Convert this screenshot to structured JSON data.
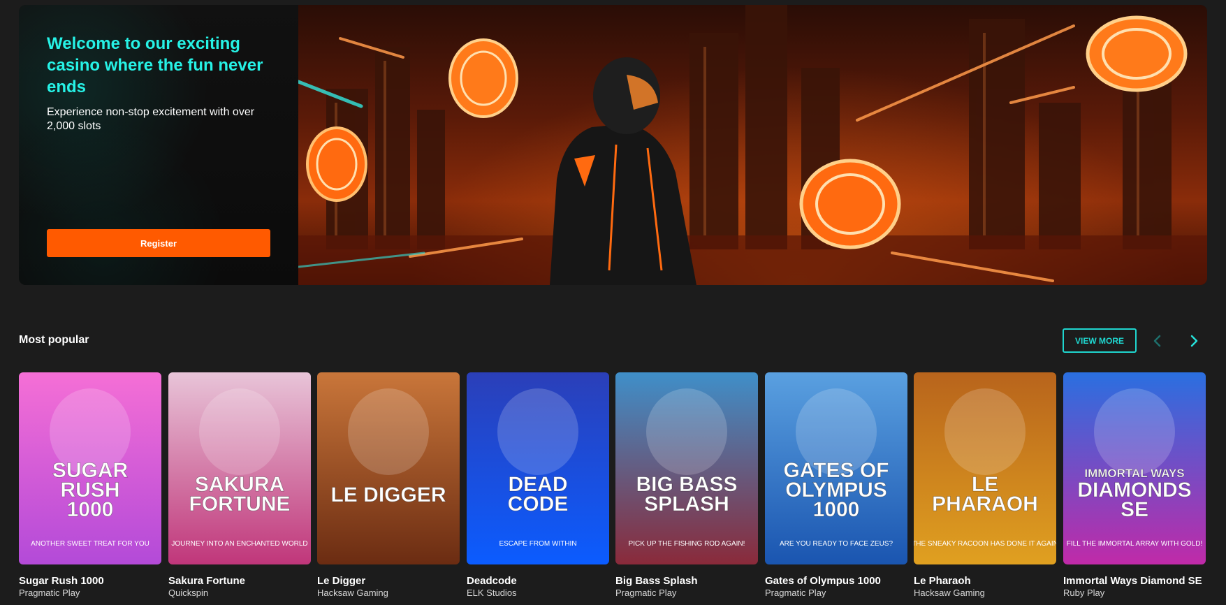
{
  "hero": {
    "title": "Welcome to our exciting casino where the fun never ends",
    "subtitle": "Experience non-stop excitement with over 2,000 slots",
    "register_label": "Register"
  },
  "popular": {
    "title": "Most popular",
    "view_more_label": "VIEW MORE",
    "prev_icon": "chevron-left-icon",
    "next_icon": "chevron-right-icon",
    "games": [
      {
        "name": "Sugar Rush 1000",
        "provider": "Pragmatic Play",
        "art_title": [
          "SUGAR",
          "RUSH",
          "1000"
        ],
        "tagline": "ANOTHER SWEET TREAT FOR YOU",
        "colors": [
          "#f56fd6",
          "#b34ad8"
        ]
      },
      {
        "name": "Sakura Fortune",
        "provider": "Quickspin",
        "art_title": [
          "SAKURA",
          "FORTUNE"
        ],
        "tagline": "JOURNEY INTO AN ENCHANTED WORLD",
        "colors": [
          "#e8c4d8",
          "#c0367a"
        ]
      },
      {
        "name": "Le Digger",
        "provider": "Hacksaw Gaming",
        "art_title": [
          "LE DIGGER"
        ],
        "tagline": "",
        "colors": [
          "#c9763a",
          "#6b2c12"
        ]
      },
      {
        "name": "Deadcode",
        "provider": "ELK Studios",
        "art_title": [
          "DEAD",
          "CODE"
        ],
        "tagline": "ESCAPE FROM WITHIN",
        "colors": [
          "#2b3fb8",
          "#0b5cff"
        ]
      },
      {
        "name": "Big Bass Splash",
        "provider": "Pragmatic Play",
        "art_title": [
          "BIG BASS",
          "SPLASH"
        ],
        "tagline": "PICK UP THE FISHING ROD AGAIN!",
        "colors": [
          "#3f8fc9",
          "#8a2a3a"
        ]
      },
      {
        "name": "Gates of Olympus 1000",
        "provider": "Pragmatic Play",
        "art_title": [
          "GATES OF",
          "OLYMPUS",
          "1000"
        ],
        "tagline": "ARE YOU READY TO FACE ZEUS?",
        "colors": [
          "#5aa0e0",
          "#1a55b0"
        ]
      },
      {
        "name": "Le Pharaoh",
        "provider": "Hacksaw Gaming",
        "art_title": [
          "LE",
          "PHARAOH"
        ],
        "tagline": "THE SNEAKY RACOON HAS DONE IT AGAIN",
        "colors": [
          "#b8641c",
          "#e0a020"
        ]
      },
      {
        "name": "Immortal Ways Diamond SE",
        "provider": "Ruby Play",
        "art_title": [
          "IMMORTAL WAYS",
          "DIAMONDS",
          "SE"
        ],
        "tagline": "FILL THE IMMORTAL ARRAY WITH GOLD!",
        "colors": [
          "#2a6fe0",
          "#c02aa8"
        ]
      }
    ]
  },
  "colors": {
    "accent_teal": "#26f2e6",
    "register_orange": "#ff5a00",
    "background": "#1c1c1c"
  }
}
